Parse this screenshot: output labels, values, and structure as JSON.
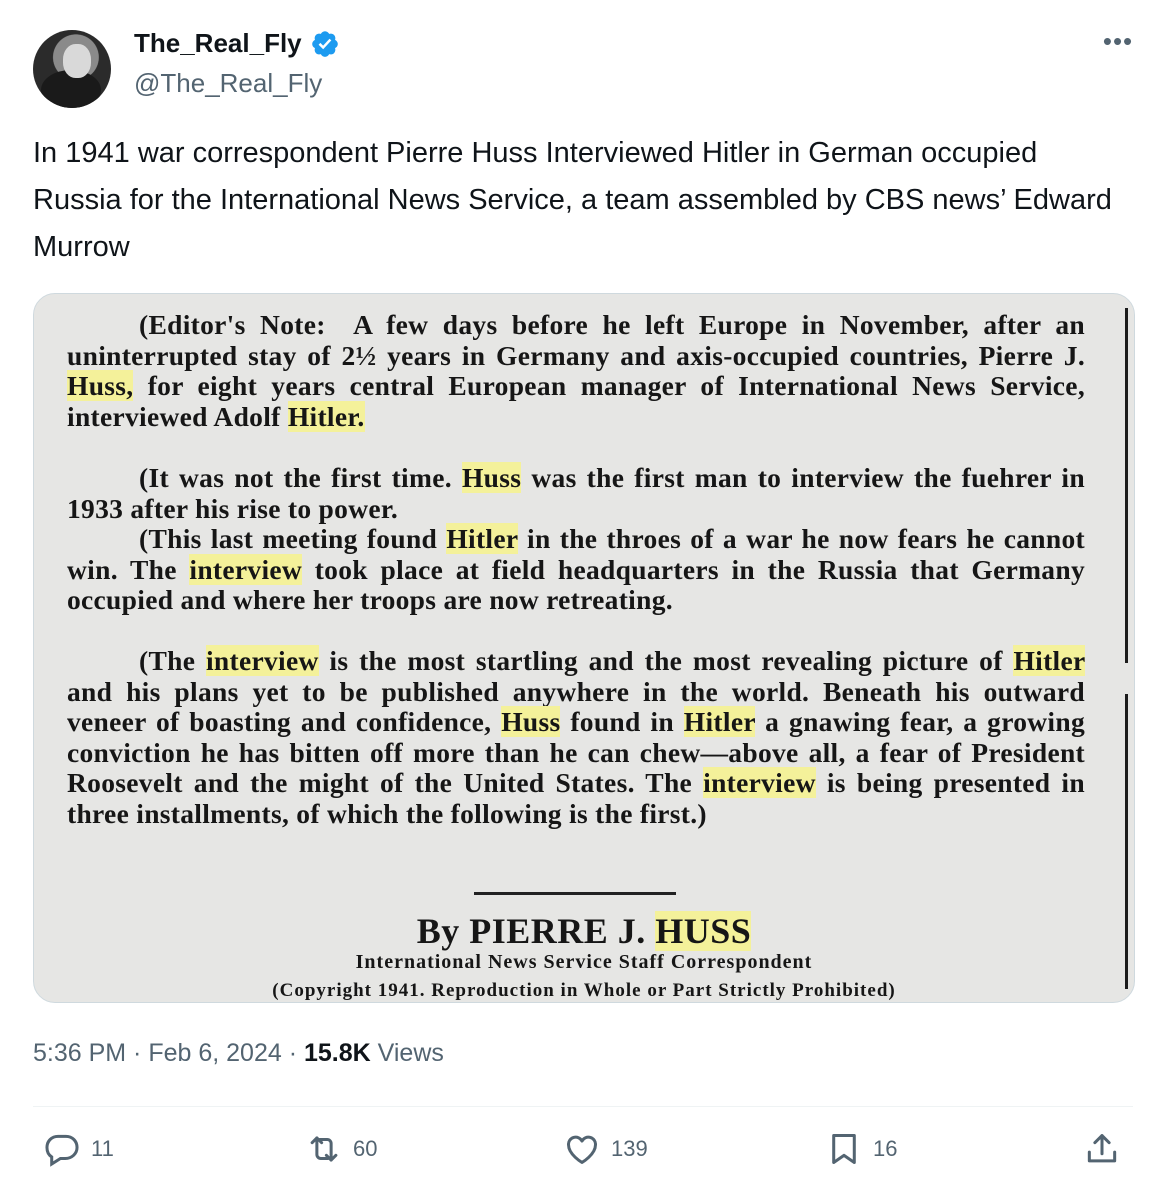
{
  "user": {
    "display_name": "The_Real_Fly",
    "handle": "@The_Real_Fly"
  },
  "tweet": {
    "text": "In 1941 war correspondent Pierre Huss Interviewed Hitler in German occupied Russia for the International News Service, a team assembled by CBS news’ Edward Murrow"
  },
  "clipping": {
    "editors_note_label": "(Editor's Note:",
    "p1": "A few days before he left Europe in November, after an uninterrupted stay of 2½ years in Germany and axis-occupied countries, Pierre J.",
    "p1_hl": "Huss,",
    "p1_b": "for eight years central European manager of International News Service, interviewed Adolf",
    "p1_hl2": "Hitler.",
    "p2_a": "(It was not the first time.",
    "p2_hl": "Huss",
    "p2_b": "was the first man to interview the fuehrer in 1933 after his rise to power.",
    "p3_a": "(This last meeting found",
    "p3_hl": "Hitler",
    "p3_b": "in the throes of a war he now fears he cannot win. The",
    "p3_hl2": "interview",
    "p3_c": "took place at field headquarters in the Russia that Germany occupied and where her troops are now retreating.",
    "p4_a": "(The",
    "p4_hl": "interview",
    "p4_b": "is the most startling and the most revealing picture of",
    "p4_hl2": "Hitler",
    "p4_c": "and his plans yet to be published anywhere in the world. Beneath his outward veneer of boasting and confidence,",
    "p4_hl3": "Huss",
    "p4_d": "found in",
    "p4_hl4": "Hitler",
    "p4_e": "a gnawing fear, a growing conviction he has bitten off more than he can chew—above all, a fear of President Roosevelt and the might of the United States. The",
    "p4_hl5": "interview",
    "p4_f": "is being presented in three installments, of which the following is the first.)",
    "byline_a": "By PIERRE J.",
    "byline_hl": "HUSS",
    "subline": "International News Service Staff Correspondent",
    "copyline": "(Copyright 1941. Reproduction in Whole or Part Strictly Prohibited)"
  },
  "meta": {
    "time": "5:36 PM",
    "dot1": " · ",
    "date": "Feb 6, 2024",
    "dot2": " · ",
    "views_count": "15.8K",
    "views_label": " Views"
  },
  "actions": {
    "replies": "11",
    "reposts": "60",
    "likes": "139",
    "bookmarks": "16"
  },
  "colors": {
    "verified": "#1d9bf0",
    "highlight": "#f4f19a",
    "muted_text": "#536471"
  }
}
